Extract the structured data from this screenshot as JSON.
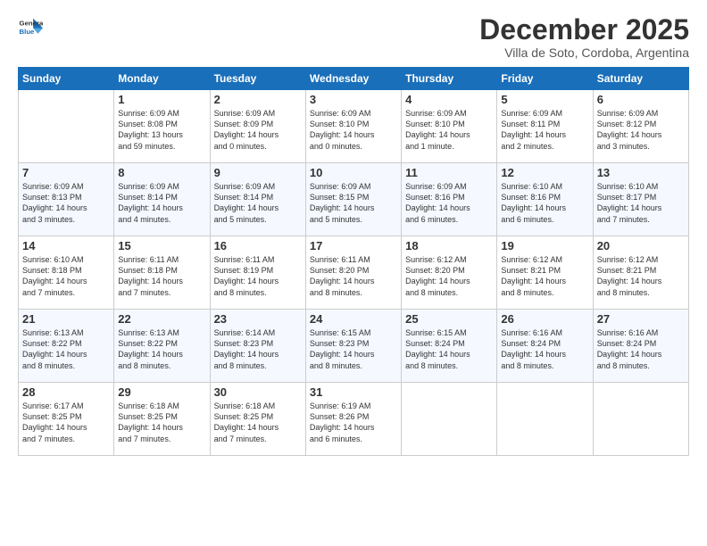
{
  "logo": {
    "line1": "General",
    "line2": "Blue"
  },
  "title": "December 2025",
  "location": "Villa de Soto, Cordoba, Argentina",
  "headers": [
    "Sunday",
    "Monday",
    "Tuesday",
    "Wednesday",
    "Thursday",
    "Friday",
    "Saturday"
  ],
  "weeks": [
    [
      {
        "day": "",
        "info": ""
      },
      {
        "day": "1",
        "info": "Sunrise: 6:09 AM\nSunset: 8:08 PM\nDaylight: 13 hours\nand 59 minutes."
      },
      {
        "day": "2",
        "info": "Sunrise: 6:09 AM\nSunset: 8:09 PM\nDaylight: 14 hours\nand 0 minutes."
      },
      {
        "day": "3",
        "info": "Sunrise: 6:09 AM\nSunset: 8:10 PM\nDaylight: 14 hours\nand 0 minutes."
      },
      {
        "day": "4",
        "info": "Sunrise: 6:09 AM\nSunset: 8:10 PM\nDaylight: 14 hours\nand 1 minute."
      },
      {
        "day": "5",
        "info": "Sunrise: 6:09 AM\nSunset: 8:11 PM\nDaylight: 14 hours\nand 2 minutes."
      },
      {
        "day": "6",
        "info": "Sunrise: 6:09 AM\nSunset: 8:12 PM\nDaylight: 14 hours\nand 3 minutes."
      }
    ],
    [
      {
        "day": "7",
        "info": "Sunrise: 6:09 AM\nSunset: 8:13 PM\nDaylight: 14 hours\nand 3 minutes."
      },
      {
        "day": "8",
        "info": "Sunrise: 6:09 AM\nSunset: 8:14 PM\nDaylight: 14 hours\nand 4 minutes."
      },
      {
        "day": "9",
        "info": "Sunrise: 6:09 AM\nSunset: 8:14 PM\nDaylight: 14 hours\nand 5 minutes."
      },
      {
        "day": "10",
        "info": "Sunrise: 6:09 AM\nSunset: 8:15 PM\nDaylight: 14 hours\nand 5 minutes."
      },
      {
        "day": "11",
        "info": "Sunrise: 6:09 AM\nSunset: 8:16 PM\nDaylight: 14 hours\nand 6 minutes."
      },
      {
        "day": "12",
        "info": "Sunrise: 6:10 AM\nSunset: 8:16 PM\nDaylight: 14 hours\nand 6 minutes."
      },
      {
        "day": "13",
        "info": "Sunrise: 6:10 AM\nSunset: 8:17 PM\nDaylight: 14 hours\nand 7 minutes."
      }
    ],
    [
      {
        "day": "14",
        "info": "Sunrise: 6:10 AM\nSunset: 8:18 PM\nDaylight: 14 hours\nand 7 minutes."
      },
      {
        "day": "15",
        "info": "Sunrise: 6:11 AM\nSunset: 8:18 PM\nDaylight: 14 hours\nand 7 minutes."
      },
      {
        "day": "16",
        "info": "Sunrise: 6:11 AM\nSunset: 8:19 PM\nDaylight: 14 hours\nand 8 minutes."
      },
      {
        "day": "17",
        "info": "Sunrise: 6:11 AM\nSunset: 8:20 PM\nDaylight: 14 hours\nand 8 minutes."
      },
      {
        "day": "18",
        "info": "Sunrise: 6:12 AM\nSunset: 8:20 PM\nDaylight: 14 hours\nand 8 minutes."
      },
      {
        "day": "19",
        "info": "Sunrise: 6:12 AM\nSunset: 8:21 PM\nDaylight: 14 hours\nand 8 minutes."
      },
      {
        "day": "20",
        "info": "Sunrise: 6:12 AM\nSunset: 8:21 PM\nDaylight: 14 hours\nand 8 minutes."
      }
    ],
    [
      {
        "day": "21",
        "info": "Sunrise: 6:13 AM\nSunset: 8:22 PM\nDaylight: 14 hours\nand 8 minutes."
      },
      {
        "day": "22",
        "info": "Sunrise: 6:13 AM\nSunset: 8:22 PM\nDaylight: 14 hours\nand 8 minutes."
      },
      {
        "day": "23",
        "info": "Sunrise: 6:14 AM\nSunset: 8:23 PM\nDaylight: 14 hours\nand 8 minutes."
      },
      {
        "day": "24",
        "info": "Sunrise: 6:15 AM\nSunset: 8:23 PM\nDaylight: 14 hours\nand 8 minutes."
      },
      {
        "day": "25",
        "info": "Sunrise: 6:15 AM\nSunset: 8:24 PM\nDaylight: 14 hours\nand 8 minutes."
      },
      {
        "day": "26",
        "info": "Sunrise: 6:16 AM\nSunset: 8:24 PM\nDaylight: 14 hours\nand 8 minutes."
      },
      {
        "day": "27",
        "info": "Sunrise: 6:16 AM\nSunset: 8:24 PM\nDaylight: 14 hours\nand 8 minutes."
      }
    ],
    [
      {
        "day": "28",
        "info": "Sunrise: 6:17 AM\nSunset: 8:25 PM\nDaylight: 14 hours\nand 7 minutes."
      },
      {
        "day": "29",
        "info": "Sunrise: 6:18 AM\nSunset: 8:25 PM\nDaylight: 14 hours\nand 7 minutes."
      },
      {
        "day": "30",
        "info": "Sunrise: 6:18 AM\nSunset: 8:25 PM\nDaylight: 14 hours\nand 7 minutes."
      },
      {
        "day": "31",
        "info": "Sunrise: 6:19 AM\nSunset: 8:26 PM\nDaylight: 14 hours\nand 6 minutes."
      },
      {
        "day": "",
        "info": ""
      },
      {
        "day": "",
        "info": ""
      },
      {
        "day": "",
        "info": ""
      }
    ]
  ]
}
